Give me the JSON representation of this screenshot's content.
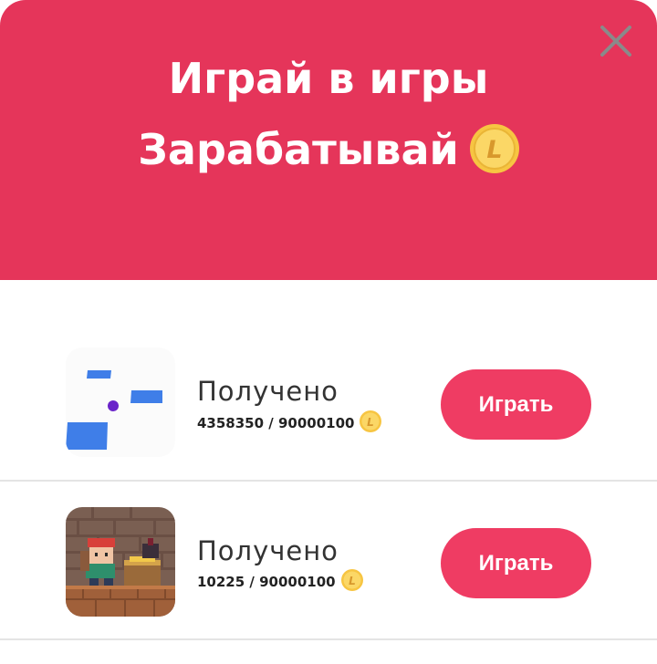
{
  "header": {
    "title": "Играй в игры",
    "subtitle": "Зарабатывай",
    "coin_icon": "coin-l-icon",
    "background": "#e5355a"
  },
  "close": {
    "icon": "close-icon"
  },
  "games": [
    {
      "label": "Получено",
      "progress": "4358350 / 90000100",
      "button": "Играть",
      "thumbnail": "blue-tiles-game-thumbnail"
    },
    {
      "label": "Получено",
      "progress": "10225 / 90000100",
      "button": "Играть",
      "thumbnail": "pixel-dungeon-game-thumbnail"
    }
  ],
  "colors": {
    "accent": "#ef3c63",
    "coin": "#f7c542"
  }
}
